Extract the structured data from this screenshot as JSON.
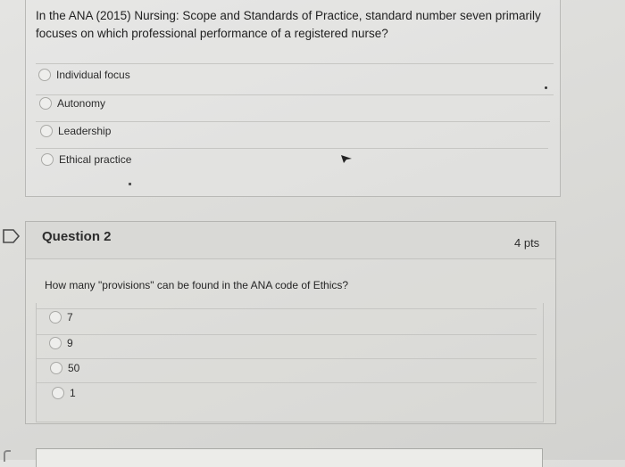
{
  "question1": {
    "text": "In the ANA (2015) Nursing: Scope and Standards of Practice, standard number seven primarily focuses on which professional performance of a registered nurse?",
    "options": [
      "Individual focus",
      "Autonomy",
      "Leadership",
      "Ethical practice"
    ]
  },
  "question2": {
    "title": "Question 2",
    "points": "4 pts",
    "text": "How many \"provisions\" can be found in the ANA code of Ethics?",
    "options": [
      "7",
      "9",
      "50",
      "1"
    ]
  }
}
